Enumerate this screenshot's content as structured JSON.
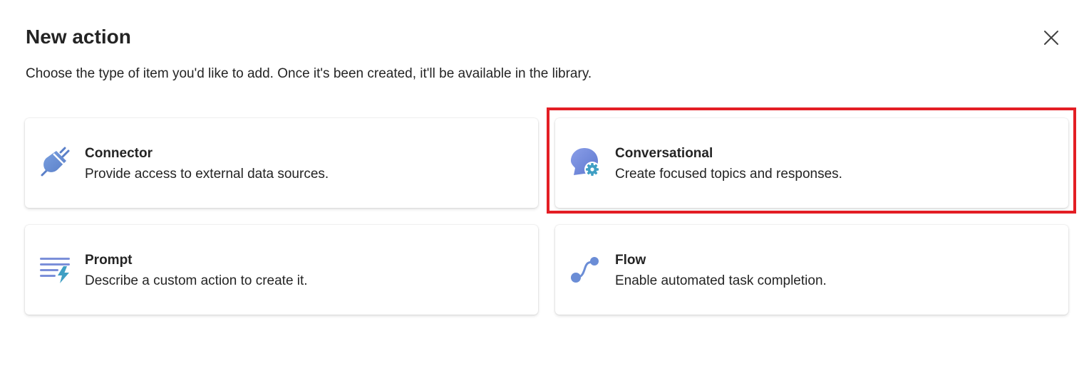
{
  "dialog": {
    "title": "New action",
    "subtitle": "Choose the type of item you'd like to add. Once it's been created, it'll be available in the library.",
    "close_icon": "close-icon"
  },
  "options": [
    {
      "title": "Connector",
      "description": "Provide access to external data sources.",
      "icon": "plug-icon"
    },
    {
      "title": "Conversational",
      "description": "Create focused topics and responses.",
      "icon": "chat-gear-icon",
      "highlighted": true
    },
    {
      "title": "Prompt",
      "description": "Describe a custom action to create it.",
      "icon": "text-lightning-icon"
    },
    {
      "title": "Flow",
      "description": "Enable automated task completion.",
      "icon": "flow-icon"
    }
  ],
  "colors": {
    "highlight": "#e31e24",
    "icon_primary": "#6b8dd6",
    "icon_accent": "#4aa3c7"
  }
}
